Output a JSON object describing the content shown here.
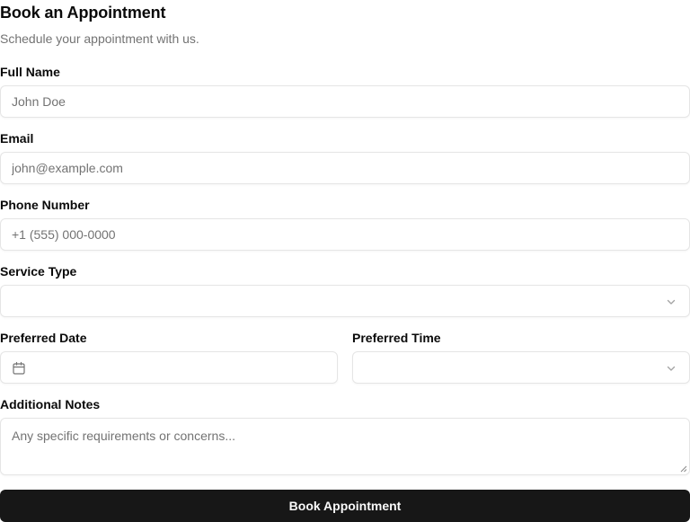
{
  "header": {
    "title": "Book an Appointment",
    "subtitle": "Schedule your appointment with us."
  },
  "fields": {
    "full_name": {
      "label": "Full Name",
      "placeholder": "John Doe",
      "value": ""
    },
    "email": {
      "label": "Email",
      "placeholder": "john@example.com",
      "value": ""
    },
    "phone": {
      "label": "Phone Number",
      "placeholder": "+1 (555) 000-0000",
      "value": ""
    },
    "service_type": {
      "label": "Service Type",
      "selected": ""
    },
    "preferred_date": {
      "label": "Preferred Date",
      "value": ""
    },
    "preferred_time": {
      "label": "Preferred Time",
      "selected": ""
    },
    "notes": {
      "label": "Additional Notes",
      "placeholder": "Any specific requirements or concerns...",
      "value": ""
    }
  },
  "submit": {
    "label": "Book Appointment"
  },
  "icons": {
    "select_chevron": "chevron-down-icon",
    "date_picker": "calendar-icon",
    "textarea_resize": "resize-handle-icon"
  },
  "colors": {
    "primary_button": "#171717",
    "primary_button_text": "#fafafa",
    "border": "#e5e5e5",
    "muted_text": "#737373",
    "foreground": "#0a0a0a"
  }
}
